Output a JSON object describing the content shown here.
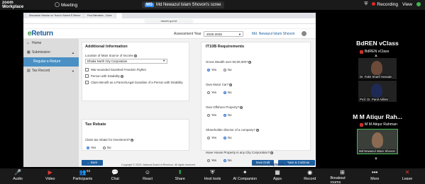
{
  "zoom": {
    "product": [
      "zoom",
      "Workplace"
    ],
    "meeting_label": "Meeting",
    "share_initials": "MS",
    "share_text": "Md Newazul Islam Shovon's scree",
    "recording": "Recording",
    "view": "View"
  },
  "browser": {
    "tabs": [
      "Discussion Session on 'How to Submit E-Return' - nationalbudget...",
      "Post Attendees - Zoom",
      ""
    ],
    "url": "etaxnbr.gov.bd"
  },
  "app": {
    "brand_e": "e",
    "brand_rest": "Return",
    "assessment_year_label": "Assessment Year",
    "assessment_year_value": "2025-2026",
    "user_name": "Md. Newazul Islam Shovon"
  },
  "sidebar": {
    "items": [
      {
        "label": "Home",
        "icon": "⌂"
      },
      {
        "label": "Submission",
        "icon": "▦"
      },
      {
        "label": "Regular e-Return",
        "icon": ""
      },
      {
        "label": "Tax Record",
        "icon": "▤"
      }
    ]
  },
  "additional": {
    "title": "Additional Information",
    "location_label": "Location of Main Source of Income",
    "location_value": "Dhaka North City Corporation",
    "checks": [
      "War-wounded Gazetted Freedom Fighter",
      "Person with Disability",
      "Claim Benefit as a Parent/Legal Guardian of a Person with Disability"
    ]
  },
  "it10b": {
    "title": "IT10B Requirements",
    "questions": [
      {
        "q": "Gross Wealth over 50,00,000?",
        "sel": "Yes"
      },
      {
        "q": "Own Motor Car?",
        "sel": "No"
      },
      {
        "q": "Own Offshore Property?",
        "sel": "No"
      },
      {
        "q": "Shareholder director of a company?",
        "sel": "No"
      },
      {
        "q": "Have House Property in any City Corporation?",
        "sel": "No"
      }
    ],
    "yes": "Yes",
    "no": "No"
  },
  "rebate": {
    "title": "Tax Rebate",
    "question": "Claim tax rebate for investment?",
    "yes": "Yes",
    "no": "No"
  },
  "actions": {
    "back": "← Back",
    "save_draft": "Save Draft",
    "save_continue": "→ Save & Continue"
  },
  "footer": {
    "copyright": "Copyright © 2025, National Board of Revenue. All rights reserved.",
    "developed_by": "Developed by",
    "developer": "Synesis IT"
  },
  "participants": [
    {
      "name": "BdREN vClass",
      "sub": "BdREN vClass"
    },
    {
      "tile": "Dr. Fakir Sharif Hossain"
    },
    {
      "tile": "Prof. Dr. Parul Akhter"
    },
    {
      "name": "M M Atiqur Rah...",
      "sub": "M M Atiqur Rahman"
    },
    {
      "tile": "Md Newazul Islam Shovon"
    }
  ],
  "toolbar": [
    {
      "label": "Audio",
      "icon": "🎤",
      "tone": "red"
    },
    {
      "label": "Video",
      "icon": "▶",
      "tone": "red"
    },
    {
      "label": "Participants",
      "icon": "👥",
      "count": "53"
    },
    {
      "label": "Chat",
      "icon": "💬"
    },
    {
      "label": "React",
      "icon": "☺"
    },
    {
      "label": "Share",
      "icon": "⬆",
      "tone": "green"
    },
    {
      "label": "Host tools",
      "icon": "⛨"
    },
    {
      "label": "AI Companion",
      "icon": "✦"
    },
    {
      "label": "Apps",
      "icon": "▦"
    },
    {
      "label": "Record",
      "icon": "◉"
    },
    {
      "label": "Breakout rooms",
      "icon": "⊞"
    },
    {
      "label": "More",
      "icon": "•••"
    },
    {
      "label": "Leave",
      "icon": "✕",
      "tone": "red"
    }
  ]
}
